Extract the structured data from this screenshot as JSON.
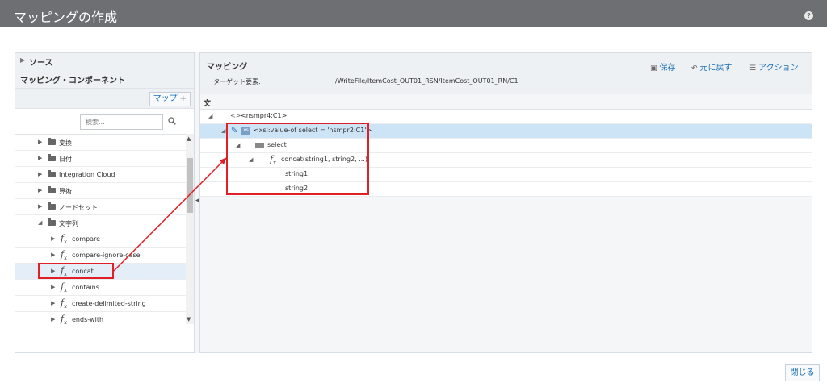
{
  "dialog": {
    "title": "マッピングの作成",
    "help_icon": "?"
  },
  "left": {
    "source_label": "ソース",
    "components_label": "マッピング・コンポーネント",
    "map_button": "マップ",
    "search_placeholder": "検索...",
    "tree": [
      {
        "label": "変換",
        "type": "folder"
      },
      {
        "label": "日付",
        "type": "folder"
      },
      {
        "label": "Integration Cloud",
        "type": "folder"
      },
      {
        "label": "算術",
        "type": "folder"
      },
      {
        "label": "ノードセット",
        "type": "folder"
      },
      {
        "label": "文字列",
        "type": "folder-open"
      },
      {
        "label": "compare",
        "type": "function"
      },
      {
        "label": "compare-ignore-case",
        "type": "function"
      },
      {
        "label": "concat",
        "type": "function"
      },
      {
        "label": "contains",
        "type": "function"
      },
      {
        "label": "create-delimited-string",
        "type": "function"
      },
      {
        "label": "ends-with",
        "type": "function"
      }
    ]
  },
  "right": {
    "title": "マッピング",
    "target_label": "ターゲット要素:",
    "target_value": "/WriteFile/ItemCost_OUT01_RSN/ItemCost_OUT01_RN/C1",
    "actions": {
      "save": "保存",
      "undo": "元に戻す",
      "actions": "アクション"
    },
    "section_label": "文",
    "tree": [
      {
        "label": "<nsmpr4:C1>"
      },
      {
        "label": "<xsl:value-of select = 'nsmpr2:C1'>"
      },
      {
        "label": "select"
      },
      {
        "label": "concat(string1, string2, ...)"
      },
      {
        "label": "string1"
      },
      {
        "label": "string2"
      }
    ]
  },
  "footer": {
    "close_button": "閉じる"
  },
  "colors": {
    "titlebar": "#6e6f73",
    "accent": "#1a6fb5",
    "highlight": "#e01f26",
    "selected_row": "#cde3f6"
  },
  "icons": {
    "folder": "folder-icon",
    "function": "fx-icon",
    "search": "search-icon",
    "edit": "pencil-icon"
  }
}
